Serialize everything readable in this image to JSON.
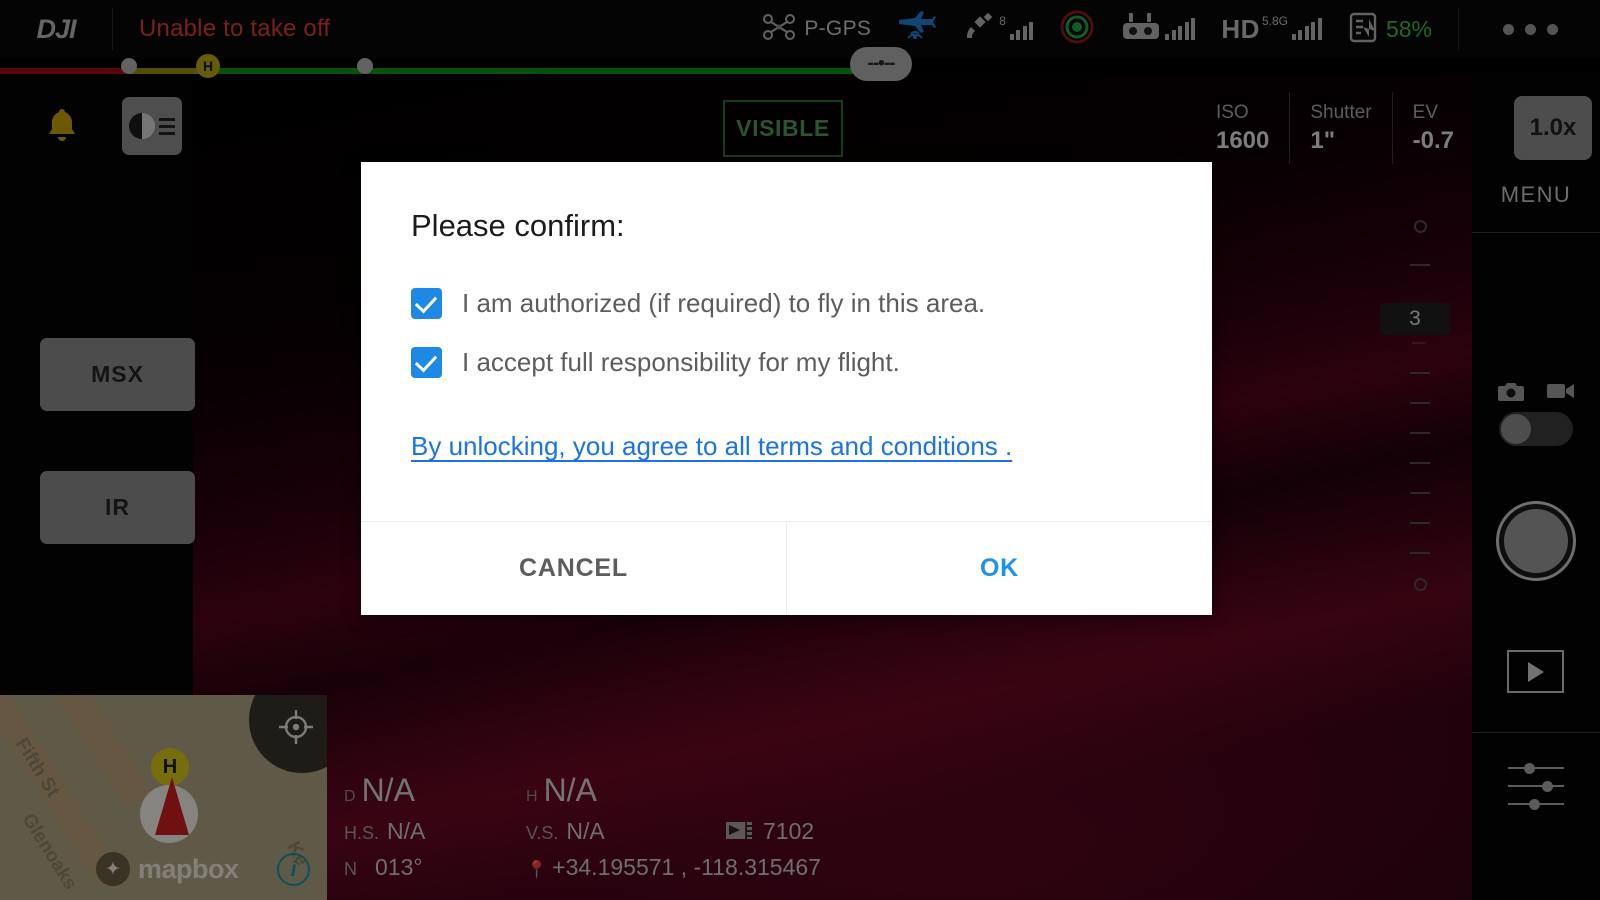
{
  "topbar": {
    "brand": "DJI",
    "warning": "Unable to take off",
    "flight_mode": "P-GPS",
    "satellite_count": "8",
    "hd_label": "HD",
    "hd_band": "5.8G",
    "battery_percent": "58%",
    "more_icon": "ellipsis-icon",
    "icons": {
      "drone": "drone-icon",
      "plane_signal": "aircraft-downlink-icon",
      "satellite": "satellite-icon",
      "vision": "vision-sensor-icon",
      "remote": "remote-controller-icon",
      "battery_mode": "battery-mode-icon"
    }
  },
  "timeline": {
    "home_marker": "H",
    "handle_glyph": "--•--",
    "segments": [
      {
        "color": "#a10b0b",
        "label": "critical"
      },
      {
        "color": "#9a8c08",
        "label": "warning"
      },
      {
        "color": "#119412",
        "label": "safe"
      }
    ]
  },
  "left_panel": {
    "bell_icon": "notification-bell-icon",
    "light_button_icon": "display-brightness-icon",
    "buttons": [
      {
        "label": "MSX"
      },
      {
        "label": "IR"
      }
    ]
  },
  "camera_overlay": {
    "visible_badge": "VISIBLE",
    "zoom_level": "1.0x",
    "params": [
      {
        "label": "ISO",
        "value": "1600"
      },
      {
        "label": "Shutter",
        "value": "1\""
      },
      {
        "label": "EV",
        "value": "-0.7"
      }
    ]
  },
  "right_panel": {
    "menu_label": "MENU",
    "photo_icon": "camera-photo-icon",
    "video_icon": "camera-video-icon",
    "mode_toggle": "photo-video-toggle",
    "shutter_button": "shutter-button",
    "playback_icon": "playback-icon",
    "settings_icon": "camera-settings-sliders-icon",
    "ev_value": "3"
  },
  "map": {
    "provider": "mapbox",
    "home_marker": "H",
    "info_badge": "i",
    "recenter_icon": "recenter-target-icon",
    "street_labels": [
      {
        "name": "Fifth St"
      },
      {
        "name": "Glenoaks"
      },
      {
        "name": "Ke"
      }
    ]
  },
  "telemetry": {
    "distance_key": "D",
    "distance_value": "N/A",
    "height_key": "H",
    "height_value": "N/A",
    "hs_key": "H.S.",
    "hs_value": "N/A",
    "vs_key": "V.S.",
    "vs_value": "N/A",
    "sd_icon": "sd-card-icon",
    "sd_value": "7102",
    "heading_key": "N",
    "heading_value": "013°",
    "location_icon": "location-pin-icon",
    "coordinates": "+34.195571 , -118.315467"
  },
  "dialog": {
    "title": "Please confirm:",
    "checkboxes": [
      {
        "label": "I am authorized (if required) to fly in this area.",
        "checked": true
      },
      {
        "label": "I accept full responsibility for my flight.",
        "checked": true
      }
    ],
    "link_text": "By unlocking, you agree to all terms and conditions .",
    "cancel_label": "CANCEL",
    "ok_label": "OK"
  },
  "colors": {
    "accent_blue": "#1e88e5",
    "link_blue": "#1a73e8",
    "ok_blue": "#1e92f0",
    "warning_red": "#e03b33",
    "battery_green": "#3fbb4a",
    "safe_green": "#119412",
    "caution_yellow": "#9a8c08",
    "critical_red": "#a10b0b"
  }
}
